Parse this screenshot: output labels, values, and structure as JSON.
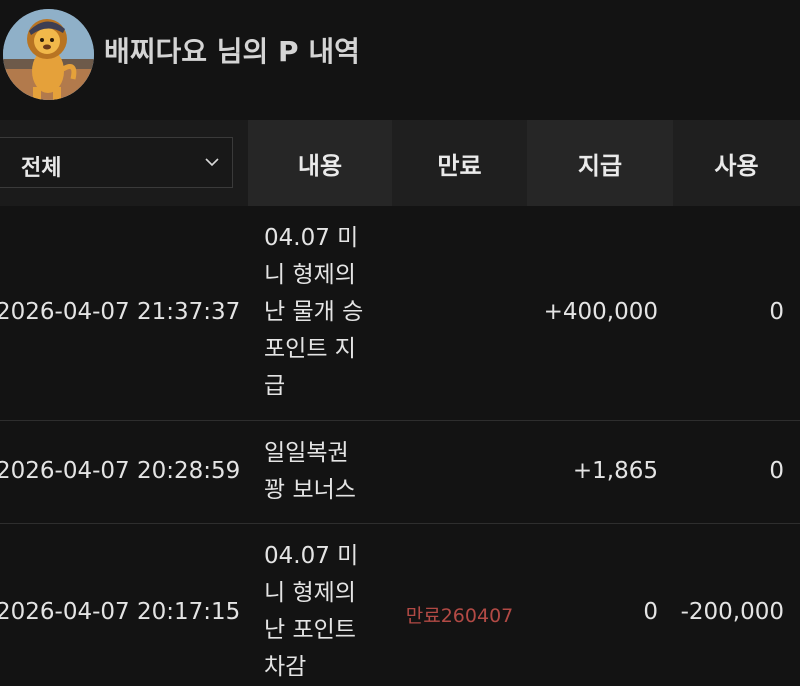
{
  "header": {
    "title": "배찌다요 님의 P 내역",
    "avatar_icon": "lion-character-avatar"
  },
  "table": {
    "filter": {
      "selected": "전체",
      "icon": "chevron-down-icon"
    },
    "columns": {
      "content": "내용",
      "expire": "만료",
      "give": "지급",
      "use": "사용"
    },
    "rows": [
      {
        "date": "2026-04-07 21:37:37",
        "content": "04.07 미니 형제의 난 물개 승 포인트 지급",
        "expire": "",
        "give": "+400,000",
        "use": "0"
      },
      {
        "date": "2026-04-07 20:28:59",
        "content": "일일복권 꽝 보너스",
        "expire": "",
        "give": "+1,865",
        "use": "0"
      },
      {
        "date": "2026-04-07 20:17:15",
        "content": "04.07 미니 형제의 난 포인트 차감",
        "expire": "만료260407",
        "give": "0",
        "use": "-200,000"
      }
    ]
  },
  "colors": {
    "background": "#131313",
    "header_cell_dark": "#1f1f1f",
    "header_cell_light": "#262626",
    "expire_red": "#b24a45"
  }
}
